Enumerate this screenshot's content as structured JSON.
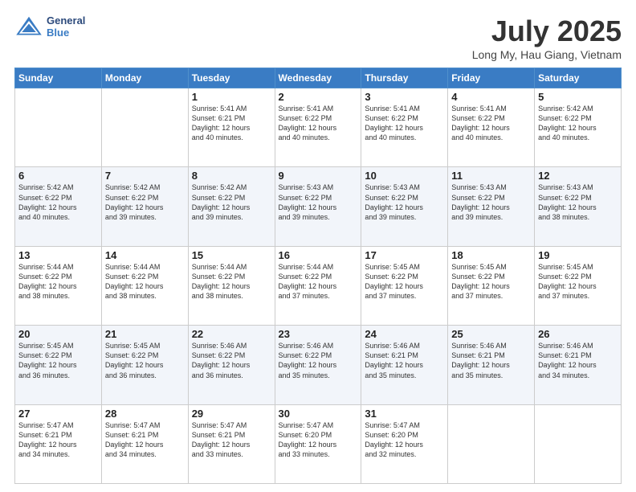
{
  "header": {
    "logo_line1": "General",
    "logo_line2": "Blue",
    "month": "July 2025",
    "location": "Long My, Hau Giang, Vietnam"
  },
  "days_of_week": [
    "Sunday",
    "Monday",
    "Tuesday",
    "Wednesday",
    "Thursday",
    "Friday",
    "Saturday"
  ],
  "weeks": [
    [
      {
        "day": "",
        "info": ""
      },
      {
        "day": "",
        "info": ""
      },
      {
        "day": "1",
        "info": "Sunrise: 5:41 AM\nSunset: 6:21 PM\nDaylight: 12 hours\nand 40 minutes."
      },
      {
        "day": "2",
        "info": "Sunrise: 5:41 AM\nSunset: 6:22 PM\nDaylight: 12 hours\nand 40 minutes."
      },
      {
        "day": "3",
        "info": "Sunrise: 5:41 AM\nSunset: 6:22 PM\nDaylight: 12 hours\nand 40 minutes."
      },
      {
        "day": "4",
        "info": "Sunrise: 5:41 AM\nSunset: 6:22 PM\nDaylight: 12 hours\nand 40 minutes."
      },
      {
        "day": "5",
        "info": "Sunrise: 5:42 AM\nSunset: 6:22 PM\nDaylight: 12 hours\nand 40 minutes."
      }
    ],
    [
      {
        "day": "6",
        "info": "Sunrise: 5:42 AM\nSunset: 6:22 PM\nDaylight: 12 hours\nand 40 minutes."
      },
      {
        "day": "7",
        "info": "Sunrise: 5:42 AM\nSunset: 6:22 PM\nDaylight: 12 hours\nand 39 minutes."
      },
      {
        "day": "8",
        "info": "Sunrise: 5:42 AM\nSunset: 6:22 PM\nDaylight: 12 hours\nand 39 minutes."
      },
      {
        "day": "9",
        "info": "Sunrise: 5:43 AM\nSunset: 6:22 PM\nDaylight: 12 hours\nand 39 minutes."
      },
      {
        "day": "10",
        "info": "Sunrise: 5:43 AM\nSunset: 6:22 PM\nDaylight: 12 hours\nand 39 minutes."
      },
      {
        "day": "11",
        "info": "Sunrise: 5:43 AM\nSunset: 6:22 PM\nDaylight: 12 hours\nand 39 minutes."
      },
      {
        "day": "12",
        "info": "Sunrise: 5:43 AM\nSunset: 6:22 PM\nDaylight: 12 hours\nand 38 minutes."
      }
    ],
    [
      {
        "day": "13",
        "info": "Sunrise: 5:44 AM\nSunset: 6:22 PM\nDaylight: 12 hours\nand 38 minutes."
      },
      {
        "day": "14",
        "info": "Sunrise: 5:44 AM\nSunset: 6:22 PM\nDaylight: 12 hours\nand 38 minutes."
      },
      {
        "day": "15",
        "info": "Sunrise: 5:44 AM\nSunset: 6:22 PM\nDaylight: 12 hours\nand 38 minutes."
      },
      {
        "day": "16",
        "info": "Sunrise: 5:44 AM\nSunset: 6:22 PM\nDaylight: 12 hours\nand 37 minutes."
      },
      {
        "day": "17",
        "info": "Sunrise: 5:45 AM\nSunset: 6:22 PM\nDaylight: 12 hours\nand 37 minutes."
      },
      {
        "day": "18",
        "info": "Sunrise: 5:45 AM\nSunset: 6:22 PM\nDaylight: 12 hours\nand 37 minutes."
      },
      {
        "day": "19",
        "info": "Sunrise: 5:45 AM\nSunset: 6:22 PM\nDaylight: 12 hours\nand 37 minutes."
      }
    ],
    [
      {
        "day": "20",
        "info": "Sunrise: 5:45 AM\nSunset: 6:22 PM\nDaylight: 12 hours\nand 36 minutes."
      },
      {
        "day": "21",
        "info": "Sunrise: 5:45 AM\nSunset: 6:22 PM\nDaylight: 12 hours\nand 36 minutes."
      },
      {
        "day": "22",
        "info": "Sunrise: 5:46 AM\nSunset: 6:22 PM\nDaylight: 12 hours\nand 36 minutes."
      },
      {
        "day": "23",
        "info": "Sunrise: 5:46 AM\nSunset: 6:22 PM\nDaylight: 12 hours\nand 35 minutes."
      },
      {
        "day": "24",
        "info": "Sunrise: 5:46 AM\nSunset: 6:21 PM\nDaylight: 12 hours\nand 35 minutes."
      },
      {
        "day": "25",
        "info": "Sunrise: 5:46 AM\nSunset: 6:21 PM\nDaylight: 12 hours\nand 35 minutes."
      },
      {
        "day": "26",
        "info": "Sunrise: 5:46 AM\nSunset: 6:21 PM\nDaylight: 12 hours\nand 34 minutes."
      }
    ],
    [
      {
        "day": "27",
        "info": "Sunrise: 5:47 AM\nSunset: 6:21 PM\nDaylight: 12 hours\nand 34 minutes."
      },
      {
        "day": "28",
        "info": "Sunrise: 5:47 AM\nSunset: 6:21 PM\nDaylight: 12 hours\nand 34 minutes."
      },
      {
        "day": "29",
        "info": "Sunrise: 5:47 AM\nSunset: 6:21 PM\nDaylight: 12 hours\nand 33 minutes."
      },
      {
        "day": "30",
        "info": "Sunrise: 5:47 AM\nSunset: 6:20 PM\nDaylight: 12 hours\nand 33 minutes."
      },
      {
        "day": "31",
        "info": "Sunrise: 5:47 AM\nSunset: 6:20 PM\nDaylight: 12 hours\nand 32 minutes."
      },
      {
        "day": "",
        "info": ""
      },
      {
        "day": "",
        "info": ""
      }
    ]
  ]
}
